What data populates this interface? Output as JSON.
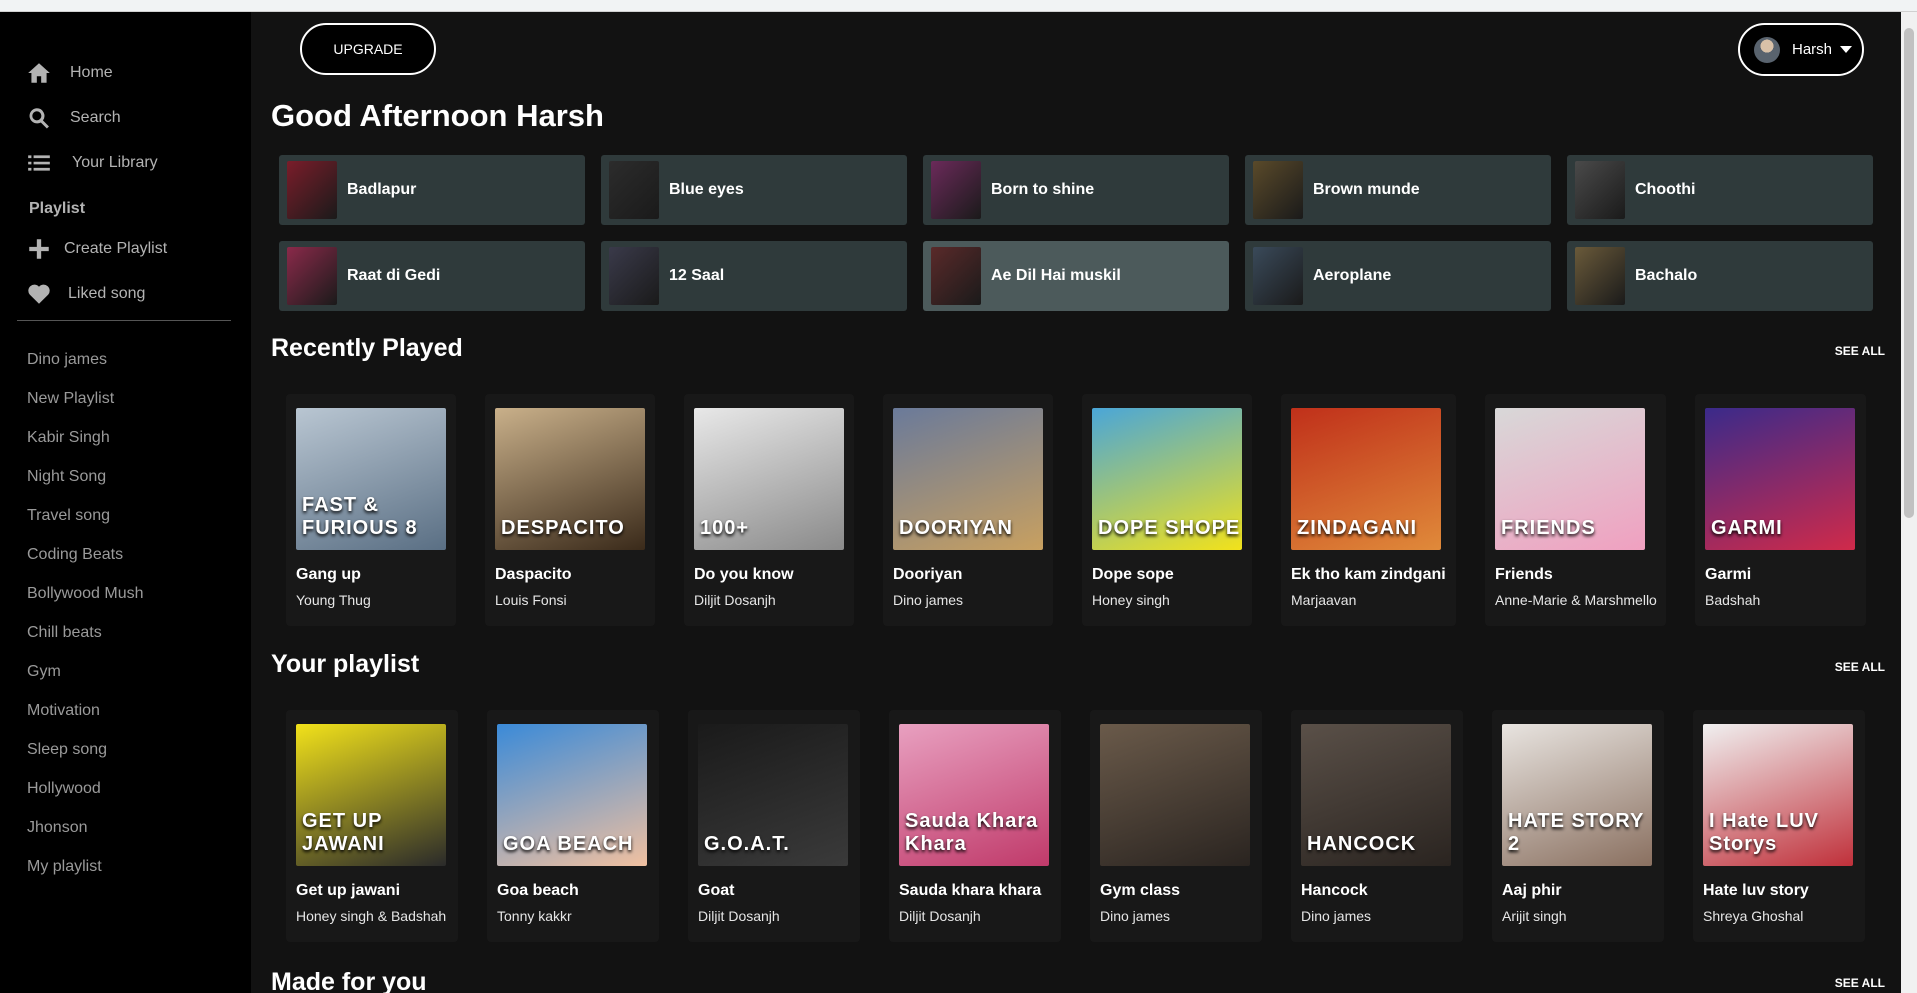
{
  "sidebar": {
    "nav": [
      {
        "label": "Home",
        "icon": "home-icon"
      },
      {
        "label": "Search",
        "icon": "search-icon"
      },
      {
        "label": "Your Library",
        "icon": "library-icon"
      }
    ],
    "playlist_heading": "Playlist",
    "actions": [
      {
        "label": "Create Playlist",
        "icon": "plus-icon"
      },
      {
        "label": "Liked song",
        "icon": "heart-icon"
      }
    ],
    "playlists": [
      "Dino james",
      "New Playlist",
      "Kabir Singh",
      "Night Song",
      "Travel song",
      "Coding Beats",
      "Bollywood Mush",
      "Chill beats",
      "Gym",
      "Motivation",
      "Sleep song",
      "Hollywood",
      "Jhonson",
      "My playlist"
    ]
  },
  "header": {
    "upgrade_label": "UPGRADE",
    "profile_name": "Harsh"
  },
  "greeting": "Good Afternoon Harsh",
  "quick_picks": [
    {
      "title": "Badlapur",
      "color": "#7a1d2a"
    },
    {
      "title": "Blue eyes",
      "color": "#2c2c2c"
    },
    {
      "title": "Born to shine",
      "color": "#6b2a5a"
    },
    {
      "title": "Brown munde",
      "color": "#5a4a2a"
    },
    {
      "title": "Choothi",
      "color": "#4a4a4a"
    },
    {
      "title": "Raat di Gedi",
      "color": "#8a2a4a"
    },
    {
      "title": "12 Saal",
      "color": "#3a3a4a"
    },
    {
      "title": "Ae Dil Hai muskil",
      "color": "#5a2a2a"
    },
    {
      "title": "Aeroplane",
      "color": "#3a4a5a"
    },
    {
      "title": "Bachalo",
      "color": "#6a5a3a"
    }
  ],
  "sections": {
    "recently_played": {
      "title": "Recently Played",
      "see_all": "SEE ALL",
      "items": [
        {
          "title": "Gang up",
          "artist": "Young Thug",
          "art_text": "FAST & FURIOUS 8",
          "color_a": "#b9c6d2",
          "color_b": "#5a6f84"
        },
        {
          "title": "Daspacito",
          "artist": "Louis Fonsi",
          "art_text": "DESPACITO",
          "color_a": "#c9b08a",
          "color_b": "#3a2a1a"
        },
        {
          "title": "Do you know",
          "artist": "Diljit Dosanjh",
          "art_text": "100+",
          "color_a": "#e8e8e8",
          "color_b": "#8a8a8a"
        },
        {
          "title": "Dooriyan",
          "artist": "Dino james",
          "art_text": "DOORIYAN",
          "color_a": "#6a7a9a",
          "color_b": "#c8a060"
        },
        {
          "title": "Dope sope",
          "artist": "Honey singh",
          "art_text": "DOPE SHOPE",
          "color_a": "#4aa6d8",
          "color_b": "#f2e21a"
        },
        {
          "title": "Ek tho kam zindgani",
          "artist": "Marjaavan",
          "art_text": "ZINDAGANI",
          "color_a": "#c0301a",
          "color_b": "#e08a3a"
        },
        {
          "title": "Friends",
          "artist": "Anne-Marie & Marshmello",
          "art_text": "FRIENDS",
          "color_a": "#d8d8d8",
          "color_b": "#f0a0c0"
        },
        {
          "title": "Garmi",
          "artist": "Badshah",
          "art_text": "GARMI",
          "color_a": "#3a2a8a",
          "color_b": "#d02a4a"
        }
      ]
    },
    "your_playlist": {
      "title": "Your playlist",
      "see_all": "SEE ALL",
      "items": [
        {
          "title": "Get up jawani",
          "artist": "Honey singh & Badshah",
          "art_text": "GET UP JAWANI",
          "color_a": "#f2e21a",
          "color_b": "#2a2a2a"
        },
        {
          "title": "Goa beach",
          "artist": "Tonny kakkr",
          "art_text": "GOA BEACH",
          "color_a": "#3a8ad8",
          "color_b": "#f0c0a0"
        },
        {
          "title": "Goat",
          "artist": "Diljit Dosanjh",
          "art_text": "G.O.A.T.",
          "color_a": "#1a1a1a",
          "color_b": "#3a3a3a"
        },
        {
          "title": "Sauda khara khara",
          "artist": "Diljit Dosanjh",
          "art_text": "Sauda Khara Khara",
          "color_a": "#e8a0c0",
          "color_b": "#c03a6a"
        },
        {
          "title": "Gym class",
          "artist": "Dino james",
          "art_text": "",
          "color_a": "#6a5a4a",
          "color_b": "#2a2420"
        },
        {
          "title": "Hancock",
          "artist": "Dino james",
          "art_text": "HANCOCK",
          "color_a": "#5a5048",
          "color_b": "#2a2420"
        },
        {
          "title": "Aaj phir",
          "artist": "Arijit singh",
          "art_text": "HATE STORY 2",
          "color_a": "#e8e4e0",
          "color_b": "#8a7060"
        },
        {
          "title": "Hate luv story",
          "artist": "Shreya Ghoshal",
          "art_text": "I Hate LUV Storys",
          "color_a": "#f0f0f0",
          "color_b": "#c0303a"
        }
      ]
    },
    "made_for_you": {
      "title": "Made for you",
      "see_all": "SEE ALL"
    }
  }
}
